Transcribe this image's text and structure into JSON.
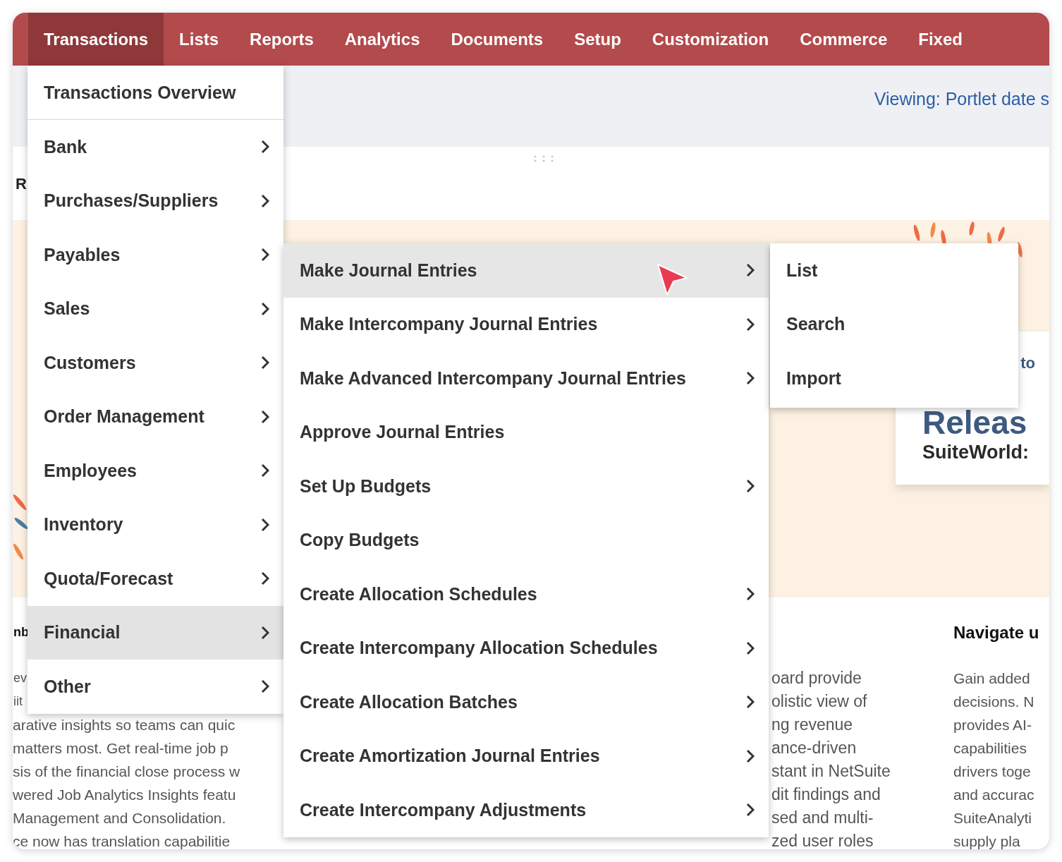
{
  "nav": {
    "items": [
      {
        "label": "Transactions",
        "selected": true
      },
      {
        "label": "Lists",
        "selected": false
      },
      {
        "label": "Reports",
        "selected": false
      },
      {
        "label": "Analytics",
        "selected": false
      },
      {
        "label": "Documents",
        "selected": false
      },
      {
        "label": "Setup",
        "selected": false
      },
      {
        "label": "Customization",
        "selected": false
      },
      {
        "label": "Commerce",
        "selected": false
      },
      {
        "label": "Fixed",
        "selected": false
      }
    ]
  },
  "header": {
    "viewing": "Viewing: Portlet date s"
  },
  "section_heading": "R",
  "banner": {
    "kind": "picture",
    "card": {
      "eyebrow": "to",
      "title": "Releas",
      "subtitle": "SuiteWorld:"
    }
  },
  "columns": [
    {
      "heading": "nb",
      "fragments": [
        "ev",
        "iit"
      ],
      "lines": [
        "arative insights so teams can quic",
        "matters most. Get real-time job p",
        "sis of the financial close process w",
        "wered Job Analytics Insights featu",
        "Management and Consolidation.",
        "ce now has translation capabilitie"
      ]
    },
    {
      "lines": [
        "oard provide",
        "olistic view of",
        "ng revenue",
        "ance-driven",
        "stant in NetSuite",
        "dit findings and",
        "sed and multi-",
        "zed user roles"
      ]
    },
    {
      "heading": "Navigate u",
      "lines": [
        "Gain added",
        "decisions. N",
        "provides AI-",
        "capabilities",
        "drivers toge",
        "and accurac",
        "SuiteAnalyti",
        "supply pla"
      ]
    }
  ],
  "menu": {
    "overview": "Transactions Overview",
    "items": [
      {
        "label": "Bank",
        "has_submenu": true,
        "selected": false
      },
      {
        "label": "Purchases/Suppliers",
        "has_submenu": true,
        "selected": false
      },
      {
        "label": "Payables",
        "has_submenu": true,
        "selected": false
      },
      {
        "label": "Sales",
        "has_submenu": true,
        "selected": false
      },
      {
        "label": "Customers",
        "has_submenu": true,
        "selected": false
      },
      {
        "label": "Order Management",
        "has_submenu": true,
        "selected": false
      },
      {
        "label": "Employees",
        "has_submenu": true,
        "selected": false
      },
      {
        "label": "Inventory",
        "has_submenu": true,
        "selected": false
      },
      {
        "label": "Quota/Forecast",
        "has_submenu": true,
        "selected": false
      },
      {
        "label": "Financial",
        "has_submenu": true,
        "selected": true
      },
      {
        "label": "Other",
        "has_submenu": true,
        "selected": false
      }
    ]
  },
  "submenu": {
    "items": [
      {
        "label": "Make Journal Entries",
        "has_submenu": true,
        "selected": true
      },
      {
        "label": "Make Intercompany Journal Entries",
        "has_submenu": true,
        "selected": false
      },
      {
        "label": "Make Advanced Intercompany Journal Entries",
        "has_submenu": true,
        "selected": false
      },
      {
        "label": "Approve Journal Entries",
        "has_submenu": false,
        "selected": false
      },
      {
        "label": "Set Up Budgets",
        "has_submenu": true,
        "selected": false
      },
      {
        "label": "Copy Budgets",
        "has_submenu": false,
        "selected": false
      },
      {
        "label": "Create Allocation Schedules",
        "has_submenu": true,
        "selected": false
      },
      {
        "label": "Create Intercompany Allocation Schedules",
        "has_submenu": true,
        "selected": false
      },
      {
        "label": "Create Allocation Batches",
        "has_submenu": true,
        "selected": false
      },
      {
        "label": "Create Amortization Journal Entries",
        "has_submenu": true,
        "selected": false
      },
      {
        "label": "Create Intercompany Adjustments",
        "has_submenu": true,
        "selected": false
      }
    ]
  },
  "flyout": {
    "items": [
      {
        "label": "List"
      },
      {
        "label": "Search"
      },
      {
        "label": "Import"
      }
    ]
  }
}
